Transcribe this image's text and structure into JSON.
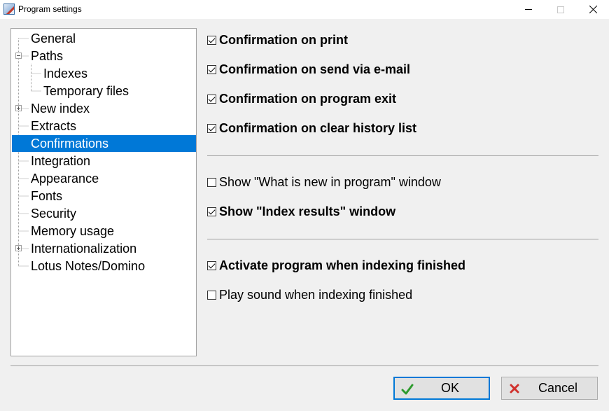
{
  "window": {
    "title": "Program settings"
  },
  "tree": {
    "items": [
      {
        "label": "General"
      },
      {
        "label": "Paths"
      },
      {
        "label": "Indexes"
      },
      {
        "label": "Temporary files"
      },
      {
        "label": "New index"
      },
      {
        "label": "Extracts"
      },
      {
        "label": "Confirmations"
      },
      {
        "label": "Integration"
      },
      {
        "label": "Appearance"
      },
      {
        "label": "Fonts"
      },
      {
        "label": "Security"
      },
      {
        "label": "Memory usage"
      },
      {
        "label": "Internationalization"
      },
      {
        "label": "Lotus Notes/Domino"
      }
    ],
    "selected": "Confirmations"
  },
  "options": [
    {
      "label": "Confirmation on print",
      "checked": true
    },
    {
      "label": "Confirmation on send via e-mail",
      "checked": true
    },
    {
      "label": "Confirmation on program exit",
      "checked": true
    },
    {
      "label": "Confirmation on clear history list",
      "checked": true
    },
    {
      "label": "Show \"What is new in program\" window",
      "checked": false
    },
    {
      "label": "Show \"Index results\" window",
      "checked": true
    },
    {
      "label": "Activate program when indexing finished",
      "checked": true
    },
    {
      "label": "Play sound when indexing finished",
      "checked": false
    }
  ],
  "buttons": {
    "ok_label": "OK",
    "cancel_label": "Cancel"
  },
  "colors": {
    "selection": "#0078d7",
    "ok_icon": "#2e9b2e",
    "cancel_icon": "#d0312d"
  }
}
